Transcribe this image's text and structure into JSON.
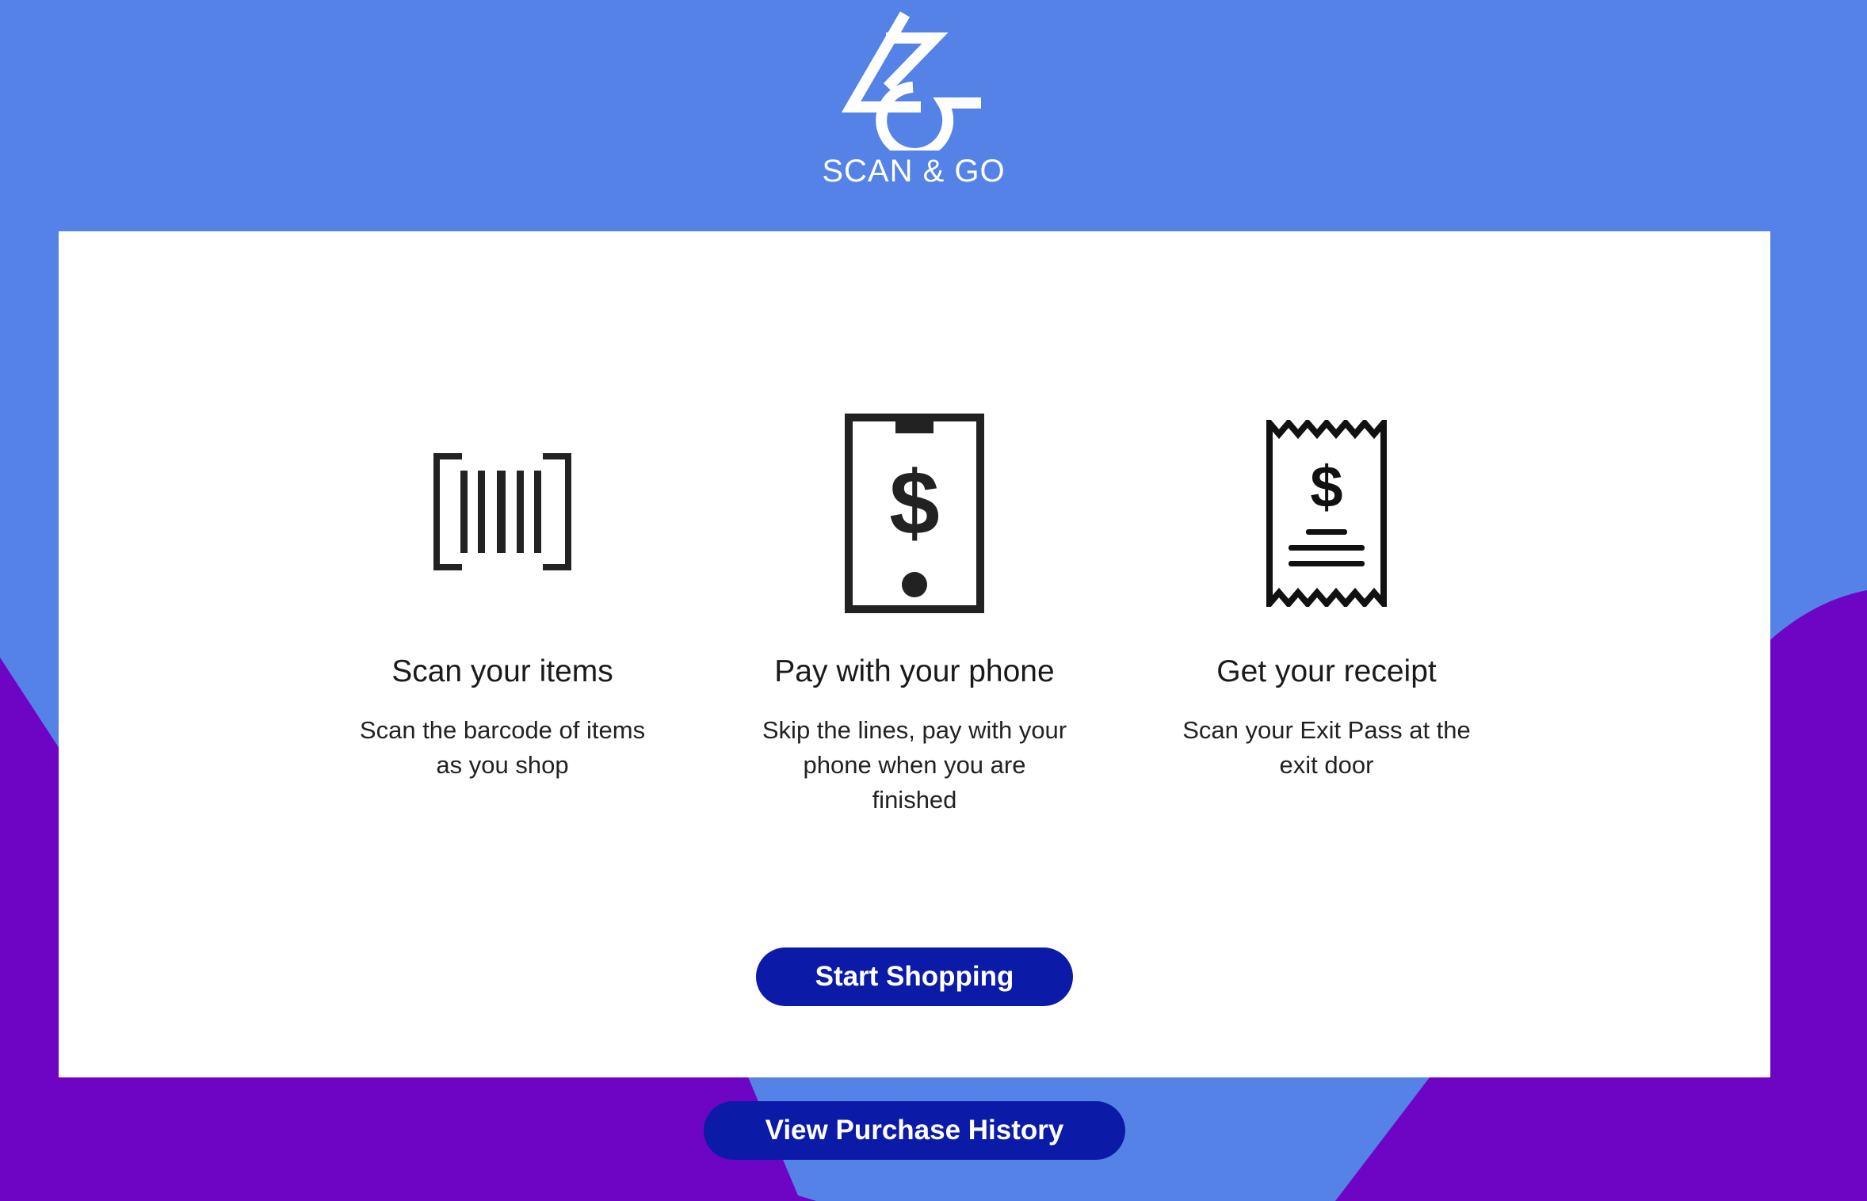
{
  "brand": {
    "logo_icon": "scan-and-go-logo-icon",
    "name": "SCAN & GO"
  },
  "steps": [
    {
      "icon": "barcode-icon",
      "title": "Scan your items",
      "description": "Scan the barcode of items as you shop"
    },
    {
      "icon": "phone-payment-icon",
      "title": "Pay with your phone",
      "description": "Skip the lines, pay with your phone when you are finished"
    },
    {
      "icon": "receipt-icon",
      "title": "Get your receipt",
      "description": "Scan your Exit Pass at the exit door"
    }
  ],
  "actions": {
    "start_label": "Start Shopping",
    "history_label": "View Purchase History"
  },
  "colors": {
    "background_blue": "#5582e6",
    "background_purple": "#6e05c4",
    "button": "#0c1aa8",
    "card": "#ffffff"
  }
}
